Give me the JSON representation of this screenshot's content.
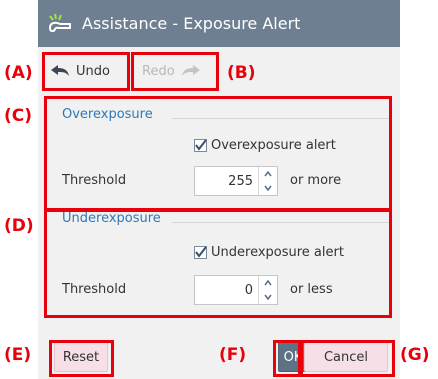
{
  "window": {
    "title": "Assistance - Exposure Alert",
    "icon": "pipe-icon"
  },
  "toolbar": {
    "undo_label": "Undo",
    "redo_label": "Redo"
  },
  "overexposure": {
    "section_title": "Overexposure",
    "checkbox_label": "Overexposure alert",
    "checked": true,
    "threshold_label": "Threshold",
    "threshold_value": "255",
    "suffix": "or more"
  },
  "underexposure": {
    "section_title": "Underexposure",
    "checkbox_label": "Underexposure alert",
    "checked": true,
    "threshold_label": "Threshold",
    "threshold_value": "0",
    "suffix": "or less"
  },
  "footer": {
    "reset_label": "Reset",
    "ok_label": "OK",
    "cancel_label": "Cancel"
  },
  "annotations": {
    "a": "(A)",
    "b": "(B)",
    "c": "(C)",
    "d": "(D)",
    "e": "(E)",
    "f": "(F)",
    "g": "(G)"
  },
  "colors": {
    "titlebar": "#6d7f90",
    "accent_text": "#2e78b8",
    "callout": "#e8000b",
    "ok_button": "#5d7285",
    "secondary_button": "#f6dfe6"
  }
}
